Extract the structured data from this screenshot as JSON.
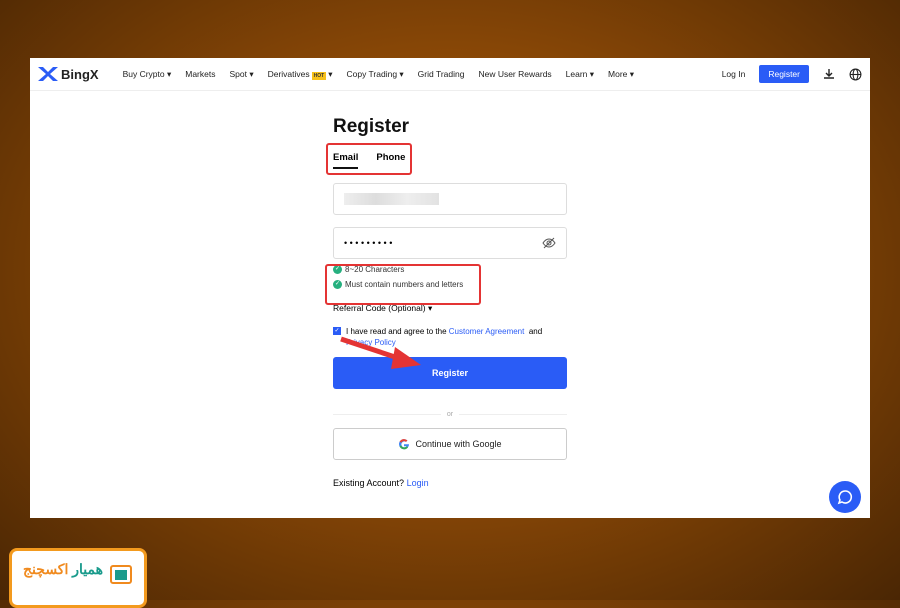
{
  "nav": {
    "brand": "BingX",
    "items": [
      "Buy Crypto ▾",
      "Markets",
      "Spot ▾",
      "Derivatives",
      "Copy Trading ▾",
      "Grid Trading",
      "New User Rewards",
      "Learn ▾",
      "More ▾"
    ],
    "hot": "HOT",
    "login": "Log In",
    "register": "Register"
  },
  "form": {
    "title": "Register",
    "tabs": [
      "Email",
      "Phone"
    ],
    "password_mask": "• • • • • • • • •",
    "rules": [
      "8~20 Characters",
      "Must contain numbers and letters"
    ],
    "referral": "Referral Code (Optional) ▾",
    "agree_prefix": "I have read and agree to the",
    "agreement": "Customer Agreement",
    "and": "and",
    "privacy": "Privacy Policy",
    "register_button": "Register",
    "or": "or",
    "google": "Continue with Google",
    "existing": "Existing Account?",
    "login": "Login"
  },
  "watermark": {
    "text": "همیار اکسچنج"
  },
  "colors": {
    "accent": "#2a5cf6",
    "highlight": "#e43434",
    "check": "#26b07f"
  }
}
